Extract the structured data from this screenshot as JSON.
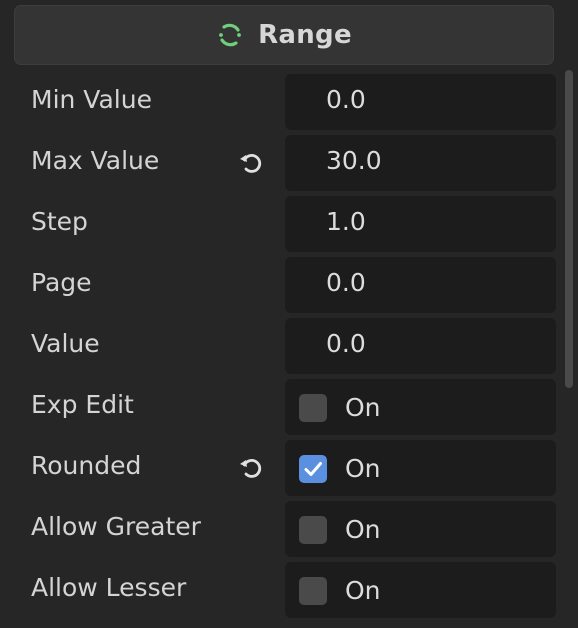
{
  "section": {
    "title": "Range",
    "icon": "range-icon",
    "icon_color": "#6fcf7a"
  },
  "properties": [
    {
      "label": "Min Value",
      "value": "0.0"
    },
    {
      "label": "Max Value",
      "value": "30.0",
      "revert": true
    },
    {
      "label": "Step",
      "value": "1.0"
    },
    {
      "label": "Page",
      "value": "0.0"
    },
    {
      "label": "Value",
      "value": "0.0"
    },
    {
      "label": "Exp Edit",
      "check_label": "On",
      "checked": false
    },
    {
      "label": "Rounded",
      "check_label": "On",
      "checked": true,
      "revert": true
    },
    {
      "label": "Allow Greater",
      "check_label": "On",
      "checked": false
    },
    {
      "label": "Allow Lesser",
      "check_label": "On",
      "checked": false
    }
  ],
  "colors": {
    "background": "#262626",
    "field": "#1c1c1c",
    "checkbox_checked": "#5b8fe0",
    "checkbox_unchecked": "#4a4a4a"
  }
}
